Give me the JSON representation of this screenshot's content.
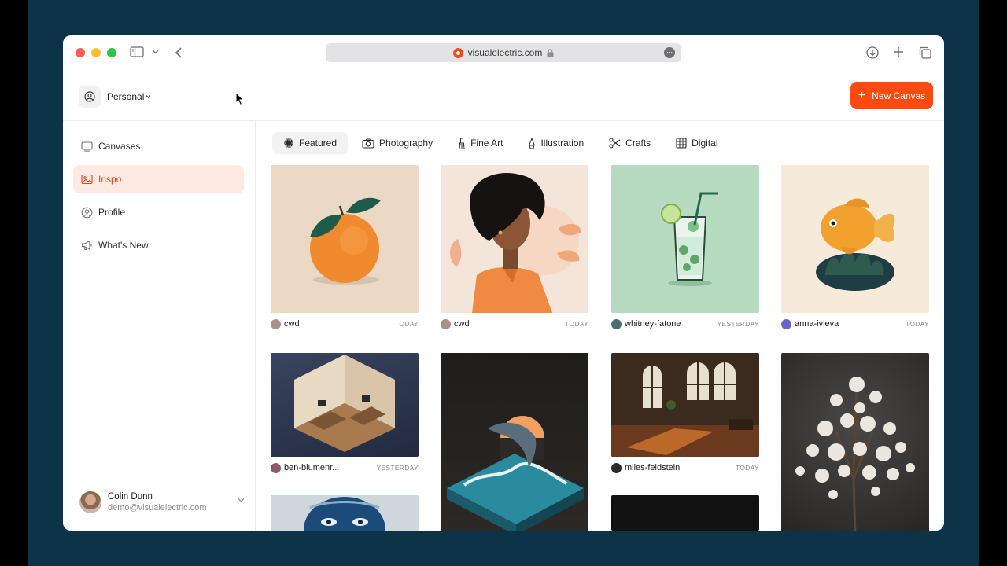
{
  "browser": {
    "url": "visualelectric.com",
    "icons": [
      "sidebar-toggle-icon",
      "chevron-down-icon",
      "back-icon",
      "lock-icon",
      "more-icon",
      "download-icon",
      "new-tab-icon",
      "tabs-overview-icon"
    ]
  },
  "header": {
    "workspace_label": "Personal",
    "new_canvas_label": "New Canvas",
    "accent_color": "#ff4a12"
  },
  "sidebar": {
    "items": [
      {
        "label": "Canvases",
        "icon": "canvases-icon"
      },
      {
        "label": "Inspo",
        "icon": "image-icon",
        "active": true
      },
      {
        "label": "Profile",
        "icon": "profile-icon"
      },
      {
        "label": "What's New",
        "icon": "megaphone-icon"
      }
    ],
    "user": {
      "name": "Colin Dunn",
      "email": "demo@visualelectric.com"
    }
  },
  "tabs": [
    {
      "label": "Featured",
      "icon": "sparkle-icon",
      "active": true
    },
    {
      "label": "Photography",
      "icon": "camera-icon"
    },
    {
      "label": "Fine Art",
      "icon": "brush-icon"
    },
    {
      "label": "Illustration",
      "icon": "pen-icon"
    },
    {
      "label": "Crafts",
      "icon": "scissors-icon"
    },
    {
      "label": "Digital",
      "icon": "grid-icon"
    }
  ],
  "gallery": [
    {
      "user": "cwd",
      "date": "TODAY",
      "subject": "orange"
    },
    {
      "user": "cwd",
      "date": "TODAY",
      "subject": "woman-portrait"
    },
    {
      "user": "whitney-fatone",
      "date": "YESTERDAY",
      "subject": "cocktail-glass"
    },
    {
      "user": "anna-ivleva",
      "date": "TODAY",
      "subject": "goldfish"
    },
    {
      "user": "ben-blumenr...",
      "date": "YESTERDAY",
      "subject": "isometric-office"
    },
    {
      "user": "",
      "date": "",
      "subject": "dolphin-wave"
    },
    {
      "user": "miles-feldstein",
      "date": "TODAY",
      "subject": "sunlit-loft"
    },
    {
      "user": "",
      "date": "",
      "subject": "blossom-branch"
    },
    {
      "user": "",
      "date": "",
      "subject": "blue-face"
    },
    {
      "user": "",
      "date": "",
      "subject": "dark-image"
    }
  ]
}
